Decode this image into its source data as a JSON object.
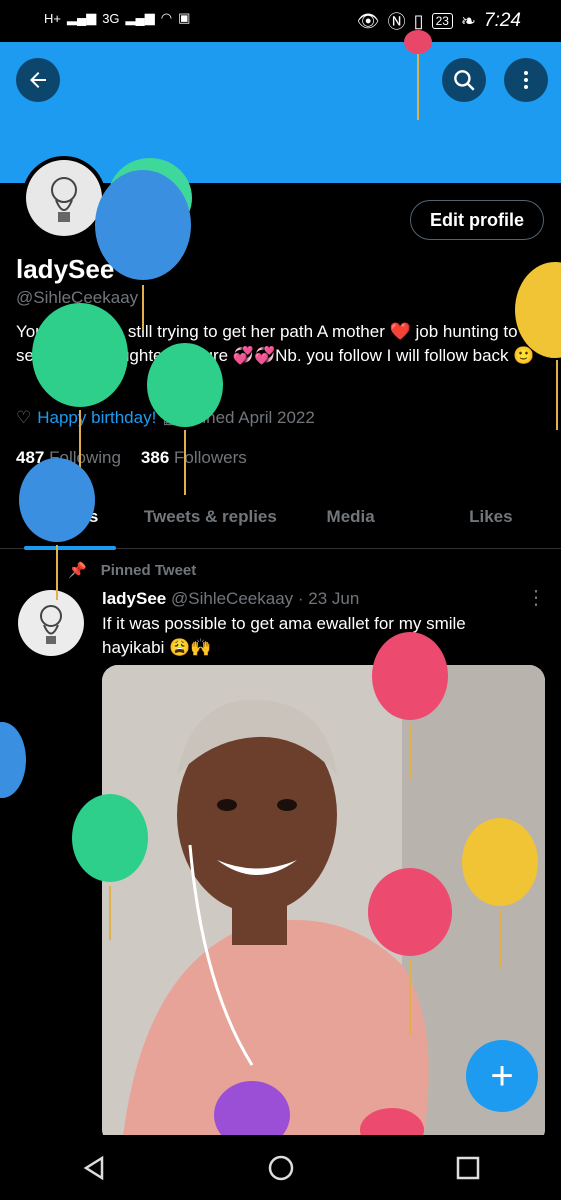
{
  "status_bar": {
    "signal_1": "H+",
    "signal_2": "3G",
    "battery": "23",
    "time": "7:24"
  },
  "profile": {
    "name": "ladySee",
    "handle": "@SihleCeekaay",
    "bio": "Young woman still trying to get her path A mother ❤️ job hunting to secure her daughter's future 💞💞Nb. you follow I will follow back 🙂",
    "birthday": "Happy birthday!",
    "joined": "Joined April 2022",
    "following_count": "487",
    "following_label": "Following",
    "followers_count": "386",
    "followers_label": "Followers",
    "edit_label": "Edit profile"
  },
  "tabs": [
    "Tweets",
    "Tweets & replies",
    "Media",
    "Likes"
  ],
  "tweet": {
    "pinned_label": "Pinned Tweet",
    "name": "ladySee",
    "handle": "@SihleCeekaay",
    "date": "· 23 Jun",
    "text": "If it was possible to get ama ewallet for my smile hayikabi 😩🙌"
  },
  "icons": {
    "back": "arrow-left-icon",
    "search": "search-icon",
    "more": "more-vertical-icon",
    "compose": "plus-icon"
  },
  "colors": {
    "accent": "#1d9bf0",
    "background": "#000000"
  }
}
